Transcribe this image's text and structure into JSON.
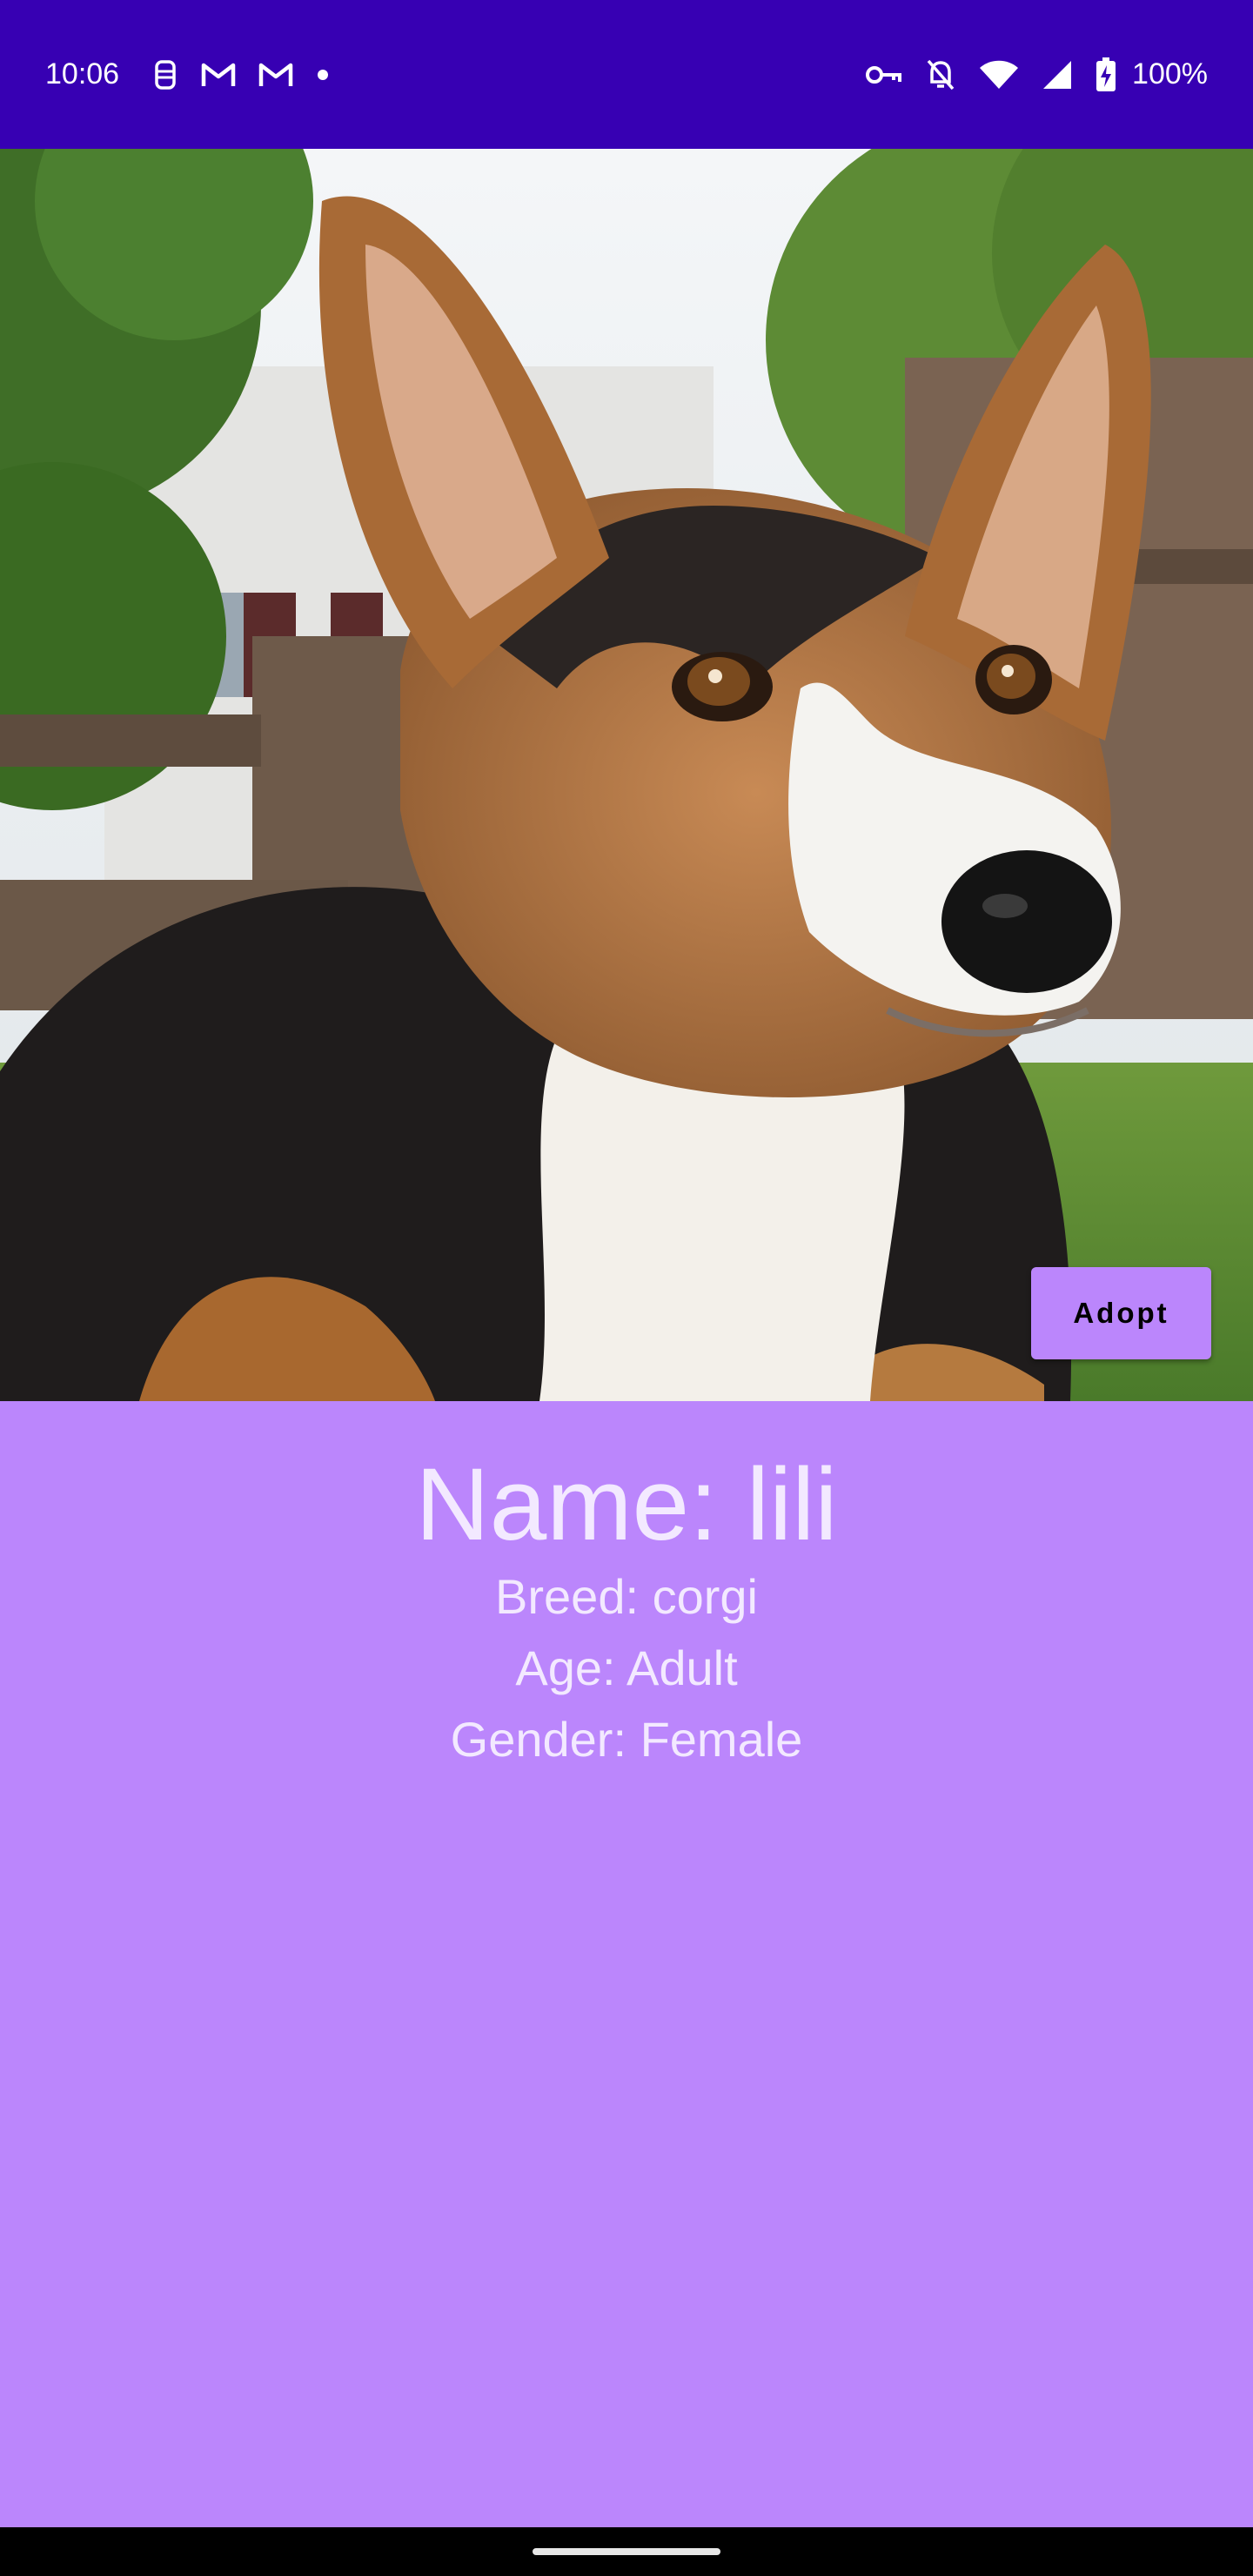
{
  "status_bar": {
    "time": "10:06",
    "battery_text": "100%",
    "left_icons": [
      "assistant-icon",
      "gmail-icon",
      "gmail-icon",
      "notification-dot-icon"
    ],
    "right_icons": [
      "vpn-key-icon",
      "do-not-disturb-icon",
      "wifi-icon",
      "cell-signal-icon",
      "battery-charging-icon"
    ],
    "background_color": "#3700B3"
  },
  "hero": {
    "image_subject": "tri-color corgi sitting on grass in front of wooden chairs",
    "adopt_label": "Adopt"
  },
  "details": {
    "name": "Name: lili",
    "breed": "Breed: corgi",
    "age": "Age: Adult",
    "gender": "Gender: Female"
  },
  "theme": {
    "accent": "#BB86FC",
    "primary_dark": "#3700B3",
    "text_on_accent": "#F3E9FF"
  }
}
